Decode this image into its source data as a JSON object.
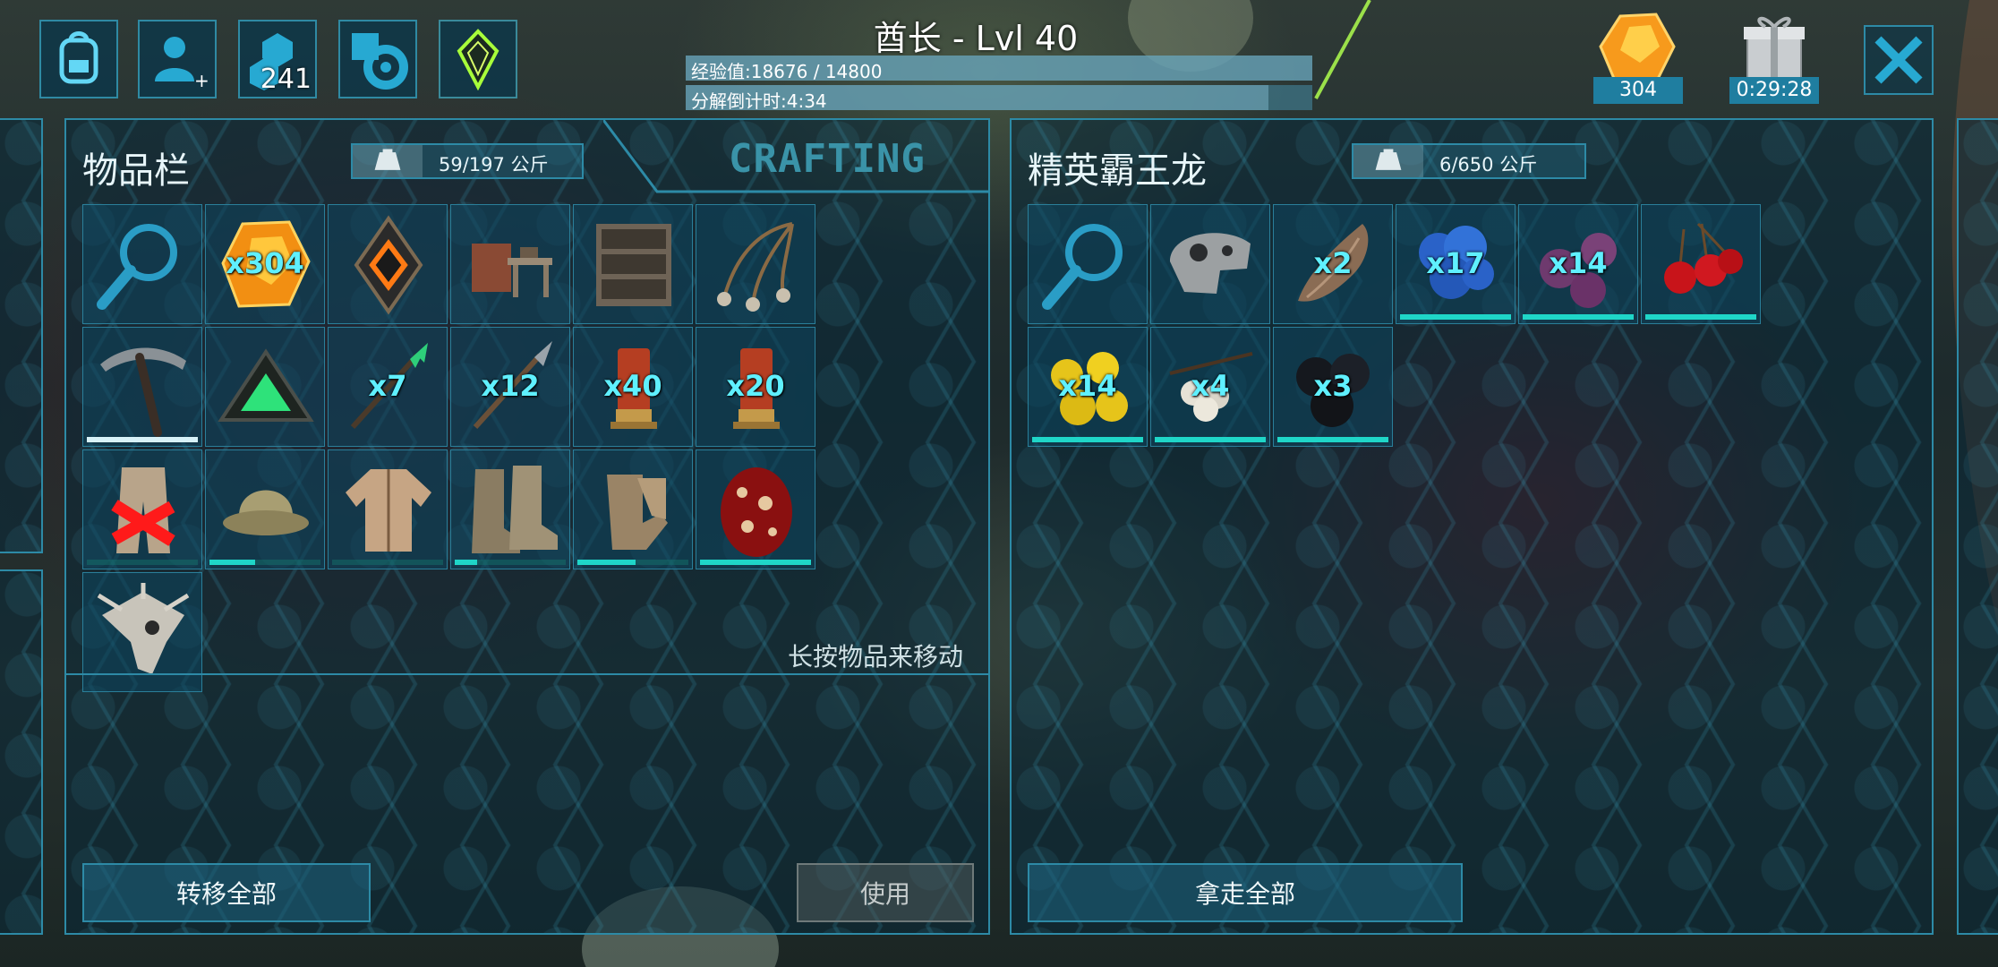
{
  "header": {
    "title": "酋长 - Lvl 40",
    "xp_label": "经验值:18676 / 14800",
    "xp_progress": 1.0,
    "decay_label": "分解倒计时:4:34",
    "decay_progress": 0.93,
    "points_badge": "241",
    "amber_count": "304",
    "gift_timer": "0:29:28"
  },
  "top_icons": [
    "backpack-icon",
    "add-player-icon",
    "engram-points-icon",
    "settings-icon",
    "tek-crystal-icon"
  ],
  "inventory": {
    "title": "物品栏",
    "weight": "59/197 公斤",
    "crafting_tab": "CRAFTING",
    "hint": "长按物品来移动",
    "transfer_all": "转移全部",
    "use": "使用",
    "slots": [
      {
        "icon": "search-icon",
        "qty": ""
      },
      {
        "icon": "amber-icon",
        "qty": "x304"
      },
      {
        "icon": "implant-icon",
        "qty": ""
      },
      {
        "icon": "smithy-icon",
        "qty": ""
      },
      {
        "icon": "shelf-icon",
        "qty": ""
      },
      {
        "icon": "bola-icon",
        "qty": ""
      },
      {
        "icon": "pickaxe-icon",
        "qty": "",
        "dur": 1.0,
        "durColor": "#d8f2f8"
      },
      {
        "icon": "tek-triangle-icon",
        "qty": ""
      },
      {
        "icon": "green-spear-icon",
        "qty": "x7"
      },
      {
        "icon": "spear-icon",
        "qty": "x12"
      },
      {
        "icon": "shell-icon",
        "qty": "x40"
      },
      {
        "icon": "shell-icon",
        "qty": "x20"
      },
      {
        "icon": "broken-pants-icon",
        "qty": "",
        "dur": 0.0
      },
      {
        "icon": "hat-icon",
        "qty": "",
        "dur": 0.45
      },
      {
        "icon": "shirt-icon",
        "qty": "",
        "dur": 0.05
      },
      {
        "icon": "boots-icon",
        "qty": "",
        "dur": 0.25
      },
      {
        "icon": "gloves-icon",
        "qty": "",
        "dur": 0.55
      },
      {
        "icon": "egg-icon",
        "qty": "",
        "dur": 1.0
      },
      {
        "icon": "trike-skull-icon",
        "qty": ""
      }
    ]
  },
  "dino": {
    "title": "精英霸王龙",
    "weight": "6/650 公斤",
    "take_all": "拿走全部",
    "slots": [
      {
        "icon": "search-icon",
        "qty": ""
      },
      {
        "icon": "rex-skull-icon",
        "qty": ""
      },
      {
        "icon": "meat-icon",
        "qty": "x2"
      },
      {
        "icon": "azulberry-icon",
        "qty": "x17",
        "dur": 1.0
      },
      {
        "icon": "mejoberry-icon",
        "qty": "x14",
        "dur": 1.0
      },
      {
        "icon": "tintoberry-icon",
        "qty": "",
        "dur": 1.0
      },
      {
        "icon": "amarberry-icon",
        "qty": "x14",
        "dur": 1.0
      },
      {
        "icon": "stimberry-icon",
        "qty": "x4",
        "dur": 1.0
      },
      {
        "icon": "narcoberry-icon",
        "qty": "x3",
        "dur": 1.0
      }
    ]
  },
  "colors": {
    "accent": "#5ff0ff",
    "durability": "#1fd6c8",
    "panel_border": "#2d8aa6"
  }
}
